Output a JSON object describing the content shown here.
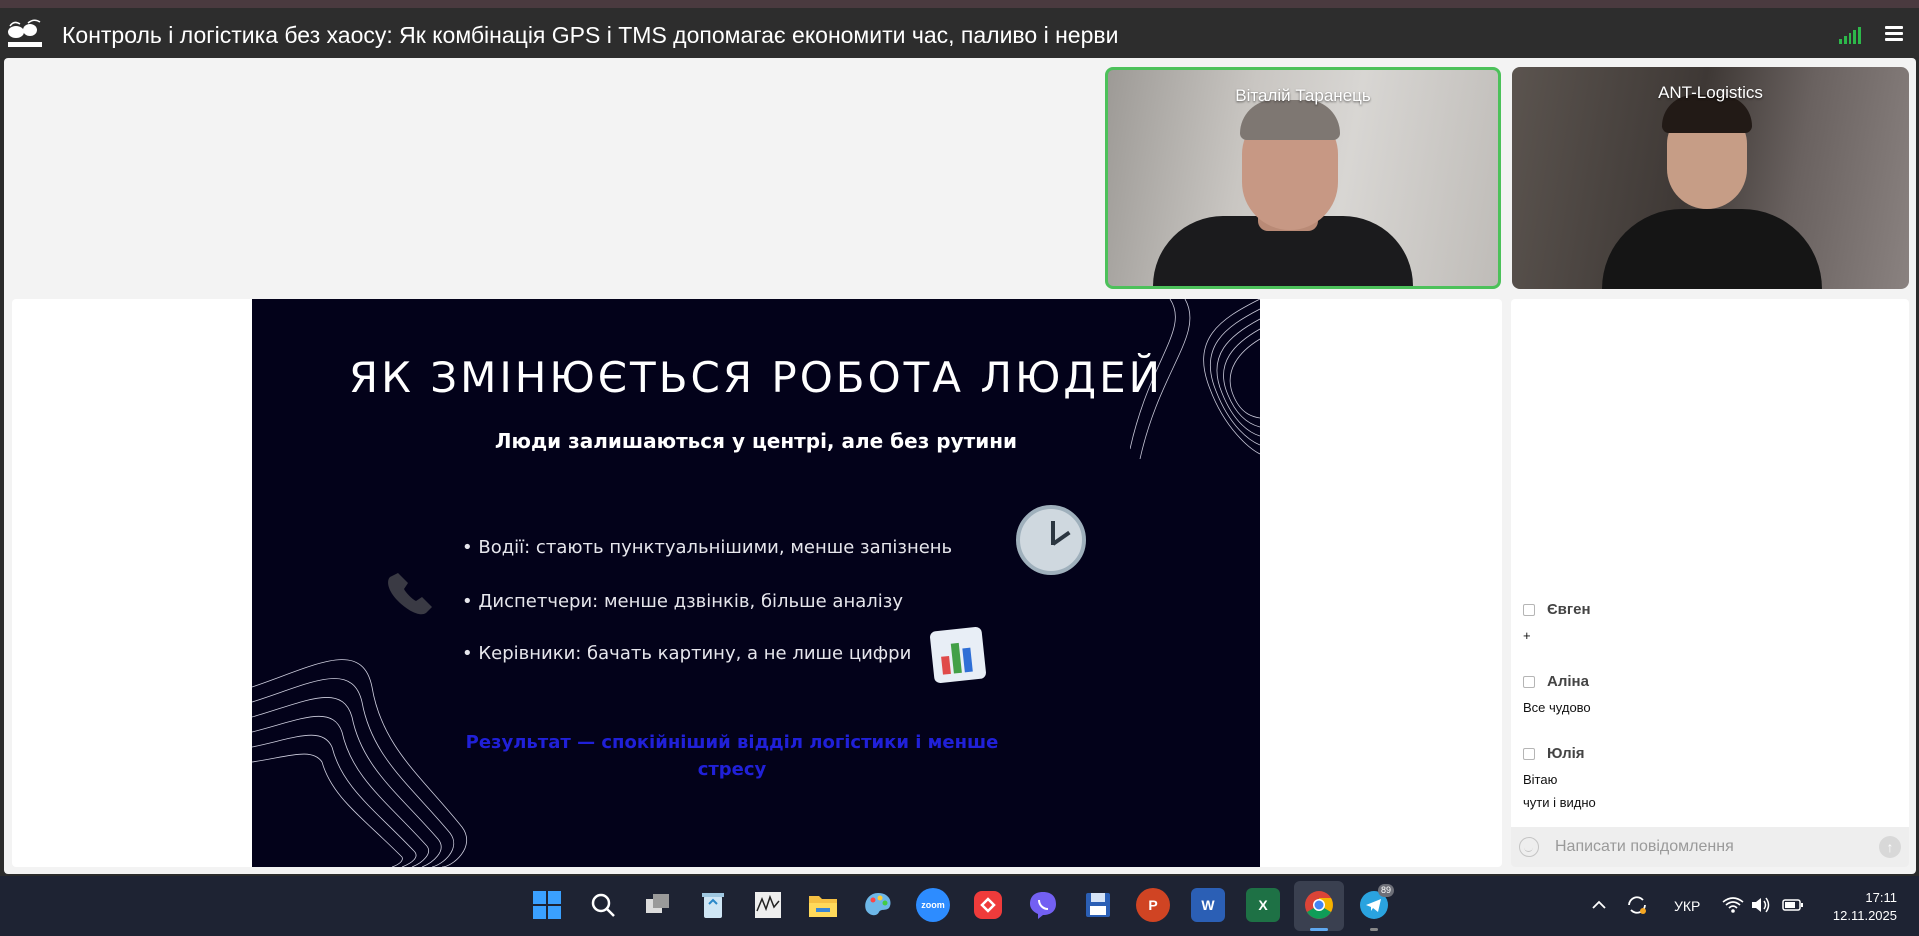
{
  "header": {
    "title": "Контроль і логістика без хаосу: Як комбінація GPS і TMS допомагає економити час, паливо і нерви",
    "logo_icon": "ant-logo-icon",
    "signal_color": "#2db84a"
  },
  "participants": [
    {
      "name": "Віталій Таранець",
      "active_speaker": true,
      "border_color": "#4cc15a"
    },
    {
      "name": "ANT-Logistics",
      "active_speaker": false
    }
  ],
  "slide": {
    "title": "ЯК ЗМІНЮЄТЬСЯ РОБОТА ЛЮДЕЙ",
    "subtitle": "Люди залишаються у центрі, але без рутини",
    "bullets": [
      "• Водії: стають пунктуальнішими, менше запізнень",
      "• Диспетчери: менше дзвінків, більше аналізу",
      "• Керівники: бачать картину, а не лише цифри"
    ],
    "result": "Результат — спокійніший відділ логістики і менше стресу",
    "icons": [
      "clock-icon",
      "phone-icon",
      "bar-chart-icon"
    ]
  },
  "chat": {
    "messages": [
      {
        "author": "Євген",
        "lines": [
          "+"
        ]
      },
      {
        "author": "Аліна",
        "lines": [
          "Все чудово"
        ]
      },
      {
        "author": "Юлія",
        "lines": [
          "Вітаю",
          "чути і видно"
        ]
      }
    ],
    "input_placeholder": "Написати повідомлення"
  },
  "taskbar": {
    "apps": [
      "start-icon",
      "search-icon",
      "task-view-icon",
      "recycle-bin-icon",
      "stock-chart-icon",
      "file-explorer-icon",
      "paint-icon",
      "zoom-icon",
      "anydesk-icon",
      "viber-icon",
      "save-disk-icon",
      "powerpoint-icon",
      "word-icon",
      "excel-icon",
      "chrome-icon",
      "telegram-icon"
    ],
    "zoom_label": "zoom",
    "telegram_badge": "89",
    "language": "УКР",
    "time": "17:11",
    "date": "12.11.2025"
  }
}
